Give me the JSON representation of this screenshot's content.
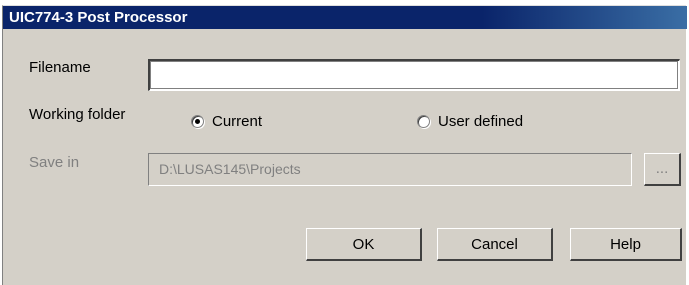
{
  "window": {
    "title": "UIC774-3 Post Processor"
  },
  "filename": {
    "label": "Filename",
    "value": ""
  },
  "working_folder": {
    "label": "Working folder",
    "options": [
      {
        "label": "Current",
        "selected": true
      },
      {
        "label": "User defined",
        "selected": false
      }
    ]
  },
  "save_in": {
    "label": "Save in",
    "value": "D:\\LUSAS145\\Projects",
    "browse_label": "..."
  },
  "buttons": {
    "ok": "OK",
    "cancel": "Cancel",
    "help": "Help"
  }
}
